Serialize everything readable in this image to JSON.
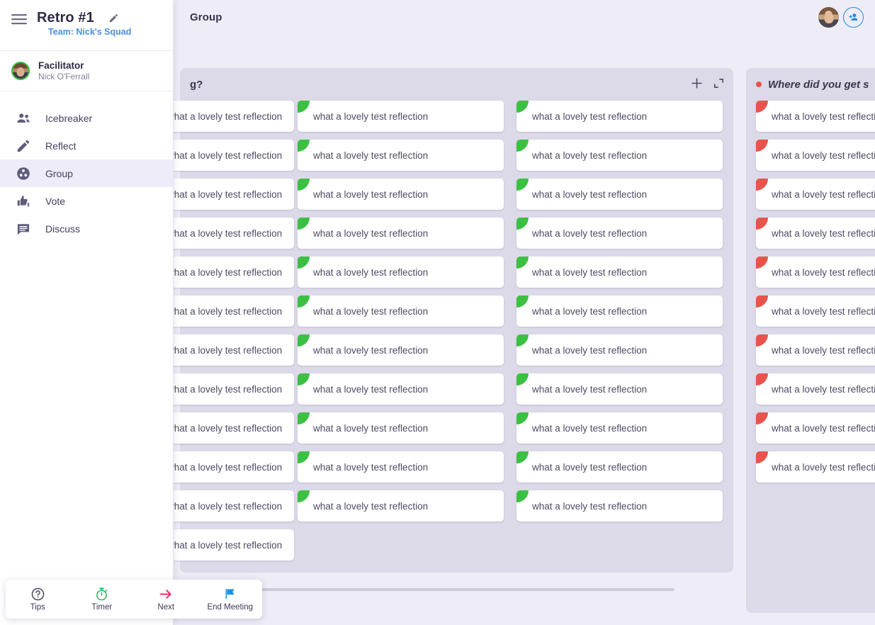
{
  "header": {
    "stage_title": "Group",
    "avatar_name": "avatar",
    "add_person_label": "add-person"
  },
  "sidebar": {
    "retro_title": "Retro #1",
    "team_name": "Team: Nick's Squad",
    "facilitator_label": "Facilitator",
    "facilitator_name": "Nick O'Ferrall",
    "items": [
      {
        "label": "Icebreaker",
        "icon": "people-icon",
        "active": false
      },
      {
        "label": "Reflect",
        "icon": "pencil-icon",
        "active": false
      },
      {
        "label": "Group",
        "icon": "group-icon",
        "active": true
      },
      {
        "label": "Vote",
        "icon": "thumbs-icon",
        "active": false
      },
      {
        "label": "Discuss",
        "icon": "chat-icon",
        "active": false
      }
    ]
  },
  "toolbar": {
    "tips_label": "Tips",
    "timer_label": "Timer",
    "next_label": "Next",
    "end_meeting_label": "End Meeting"
  },
  "board": {
    "card_text": "what a lovely test reflection",
    "columns": [
      {
        "title": "g?",
        "title_italic": false,
        "dot_color": "",
        "accent": "green",
        "add_label": "Add card",
        "collapse_label": "Collapse column",
        "cards": 12
      },
      {
        "title": "Where did you get s",
        "title_italic": true,
        "dot_color": "#e8544c",
        "accent": "red",
        "add_label": "Add card",
        "collapse_label": "Collapse column",
        "cards": 10
      }
    ],
    "group_columns_cards": [
      12,
      11,
      11
    ]
  },
  "colors": {
    "page_background": "#eeecf6",
    "column_background": "#dcdae8",
    "card_background": "#ffffff",
    "green_accent": "#3cc043",
    "red_accent": "#e8544c",
    "link_blue": "#4a8fe0",
    "next_pink": "#e8336d",
    "flag_blue": "#1f8fe0"
  }
}
